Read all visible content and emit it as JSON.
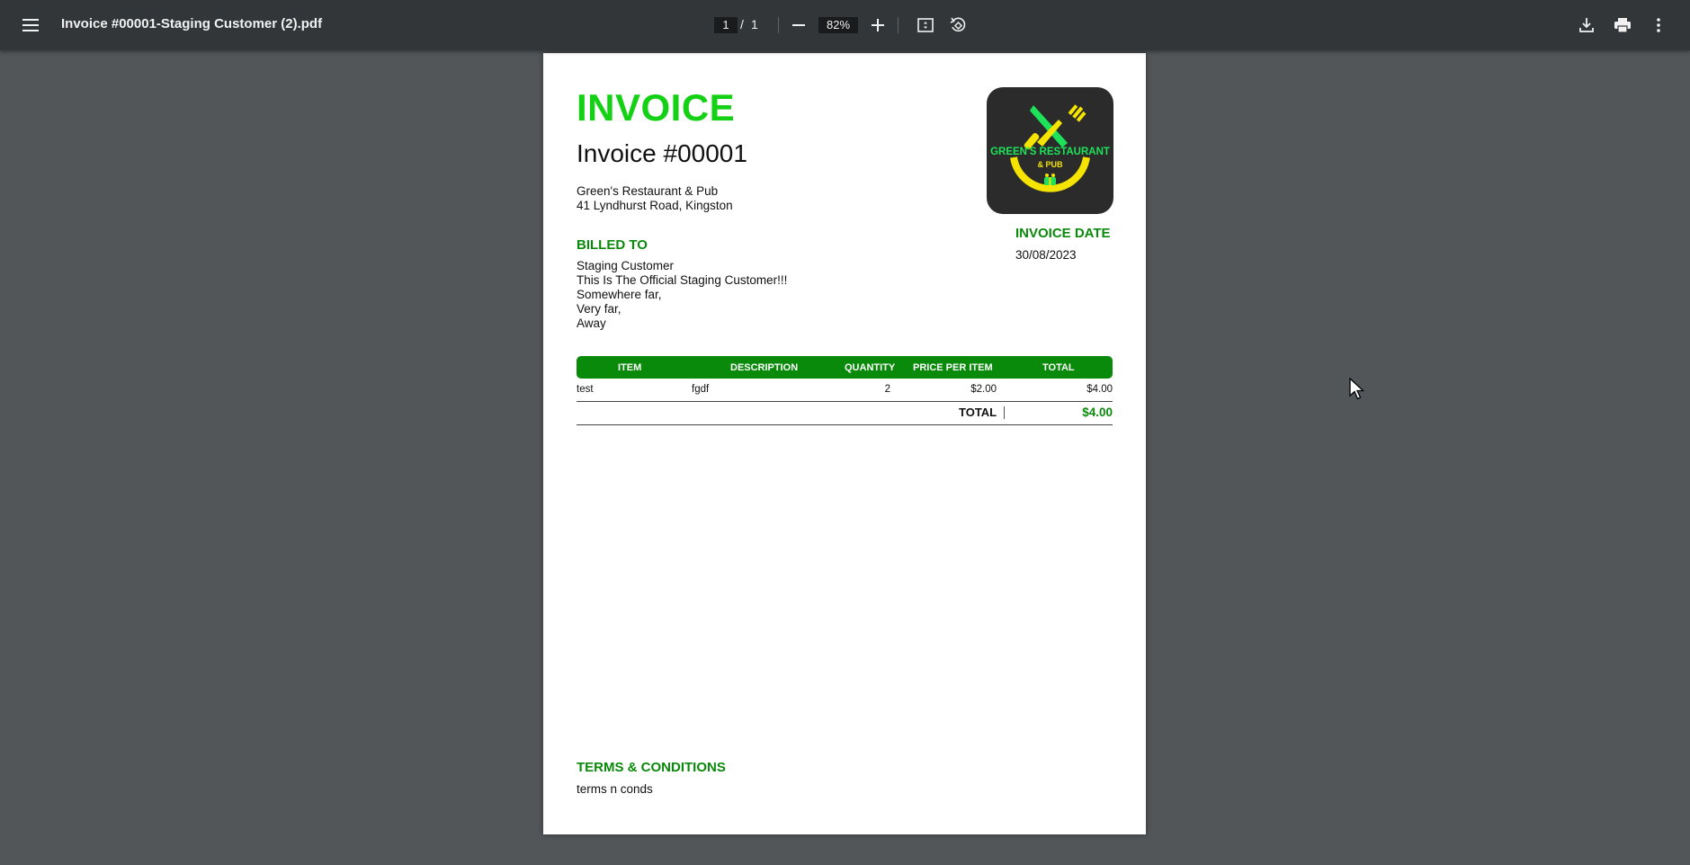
{
  "toolbar": {
    "title": "Invoice #00001-Staging Customer (2).pdf",
    "current_page": "1",
    "page_separator": "/",
    "total_pages": "1",
    "zoom": "82%",
    "icons": [
      "menu-icon",
      "zoom-out-icon",
      "zoom-in-icon",
      "fit-page-icon",
      "rotate-icon",
      "download-icon",
      "print-icon",
      "more-vert-icon"
    ]
  },
  "invoice": {
    "heading": "INVOICE",
    "number": "Invoice #00001",
    "from": {
      "name": "Green's Restaurant & Pub",
      "address": "41 Lyndhurst Road, Kingston"
    },
    "billed_to_label": "BILLED TO",
    "billed_to": [
      "Staging Customer",
      "This Is The Official Staging  Customer!!!",
      "Somewhere far,",
      "Very far,",
      "Away"
    ],
    "logo": {
      "line1": "GREEN'S RESTAURANT",
      "line2": "& PUB",
      "colors": {
        "background": "#2b2b2b",
        "green": "#1ee35a",
        "yellow": "#f5e400"
      }
    },
    "date_label": "INVOICE DATE",
    "date_value": "30/08/2023",
    "table": {
      "headers": [
        "ITEM",
        "DESCRIPTION",
        "QUANTITY",
        "PRICE PER ITEM",
        "TOTAL"
      ],
      "rows": [
        {
          "item": "test",
          "description": "fgdf",
          "quantity": "2",
          "price": "$2.00",
          "total": "$4.00"
        }
      ],
      "total_label": "TOTAL",
      "total_value": "$4.00"
    },
    "terms_label": "TERMS & CONDITIONS",
    "terms_text": "terms n conds"
  },
  "colors": {
    "accent_green": "#0a8a0a",
    "heading_green": "#15d115",
    "toolbar_bg": "#323639",
    "viewer_bg": "#525659"
  }
}
